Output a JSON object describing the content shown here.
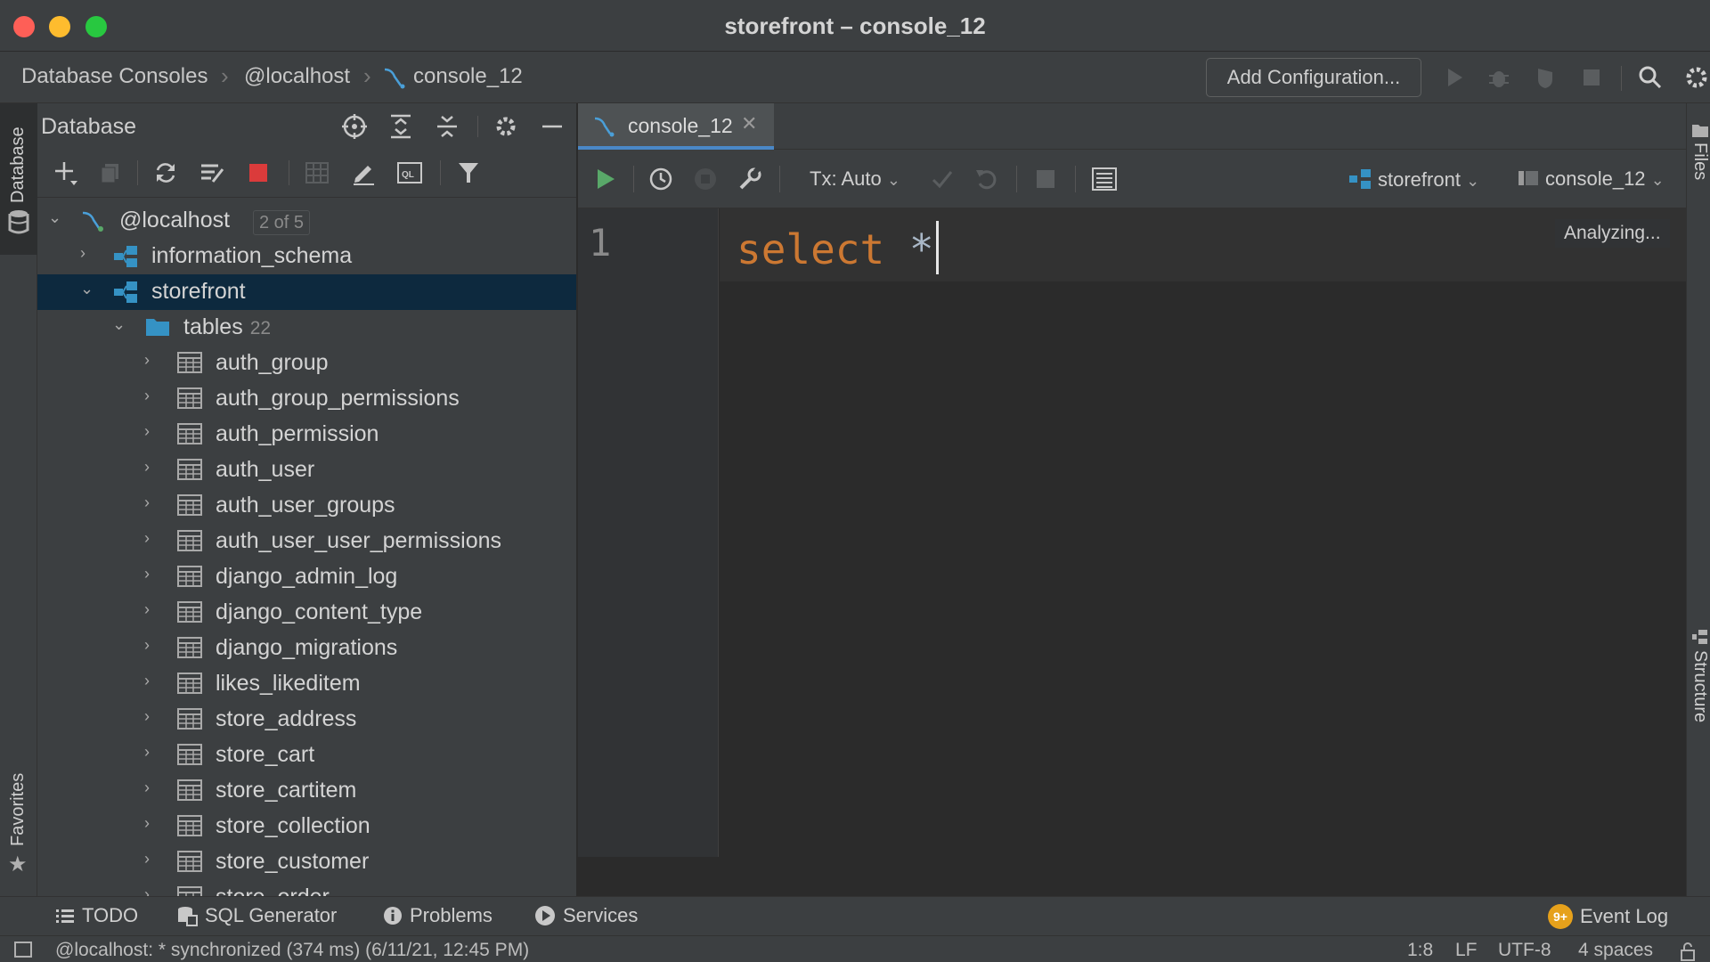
{
  "window": {
    "title": "storefront – console_12"
  },
  "navbar": {
    "breadcrumbs": [
      "Database Consoles",
      "@localhost",
      "console_12"
    ],
    "add_configuration_label": "Add Configuration..."
  },
  "left_strip": {
    "database_tab": "Database",
    "favorites_tab": "Favorites"
  },
  "right_strip": {
    "files_tab": "Files",
    "structure_tab": "Structure"
  },
  "db_panel": {
    "title": "Database",
    "tree": {
      "root": {
        "label": "@localhost",
        "badge": "2 of 5"
      },
      "schemas": [
        {
          "label": "information_schema"
        },
        {
          "label": "storefront"
        }
      ],
      "tables_folder": {
        "label": "tables",
        "count": "22"
      },
      "tables": [
        "auth_group",
        "auth_group_permissions",
        "auth_permission",
        "auth_user",
        "auth_user_groups",
        "auth_user_user_permissions",
        "django_admin_log",
        "django_content_type",
        "django_migrations",
        "likes_likeditem",
        "store_address",
        "store_cart",
        "store_cartitem",
        "store_collection",
        "store_customer",
        "store_order"
      ]
    }
  },
  "editor": {
    "tab_label": "console_12",
    "tx_mode": "Tx: Auto",
    "schema_select": "storefront",
    "session_select": "console_12",
    "line_number": "1",
    "code_keyword": "select",
    "code_rest": " *",
    "analyzing_label": "Analyzing..."
  },
  "bottom_bar": {
    "todo": "TODO",
    "sql_generator": "SQL Generator",
    "problems": "Problems",
    "services": "Services",
    "event_log": "Event Log",
    "event_badge": "9+"
  },
  "status_bar": {
    "message": "@localhost: * synchronized (374 ms) (6/11/21, 12:45 PM)",
    "position": "1:8",
    "line_ending": "LF",
    "encoding": "UTF-8",
    "indent": "4 spaces"
  },
  "colors": {
    "run_green": "#59a869",
    "stop_red": "#db3b3b",
    "keyword_orange": "#cc7832",
    "selection_blue": "#0d293e",
    "tab_underline": "#4a88c7",
    "schema_icon_blue": "#3592c4"
  }
}
